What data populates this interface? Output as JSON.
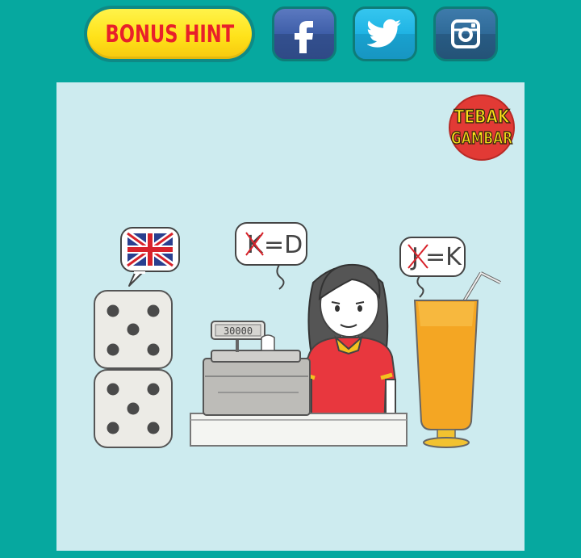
{
  "header": {
    "bonus_hint_label": "BONUS HINT",
    "social": [
      {
        "name": "facebook",
        "icon": "facebook-icon"
      },
      {
        "name": "twitter",
        "icon": "twitter-icon"
      },
      {
        "name": "instagram",
        "icon": "instagram-icon"
      }
    ]
  },
  "puzzle": {
    "logo_line1": "TEBAK",
    "logo_line2": "GAMBAR",
    "bubble_middle": {
      "struck": "K",
      "rest": "=D"
    },
    "bubble_right": {
      "struck": "J",
      "rest": "=K"
    },
    "register_display": "30000"
  },
  "colors": {
    "background": "#06a89f",
    "panel": "#cdebef",
    "bonus_yellow": "#ffe21a",
    "bonus_text_red": "#e8202a",
    "facebook": "#3e5ea8",
    "twitter": "#1fb3e3",
    "instagram": "#2f6a98"
  }
}
